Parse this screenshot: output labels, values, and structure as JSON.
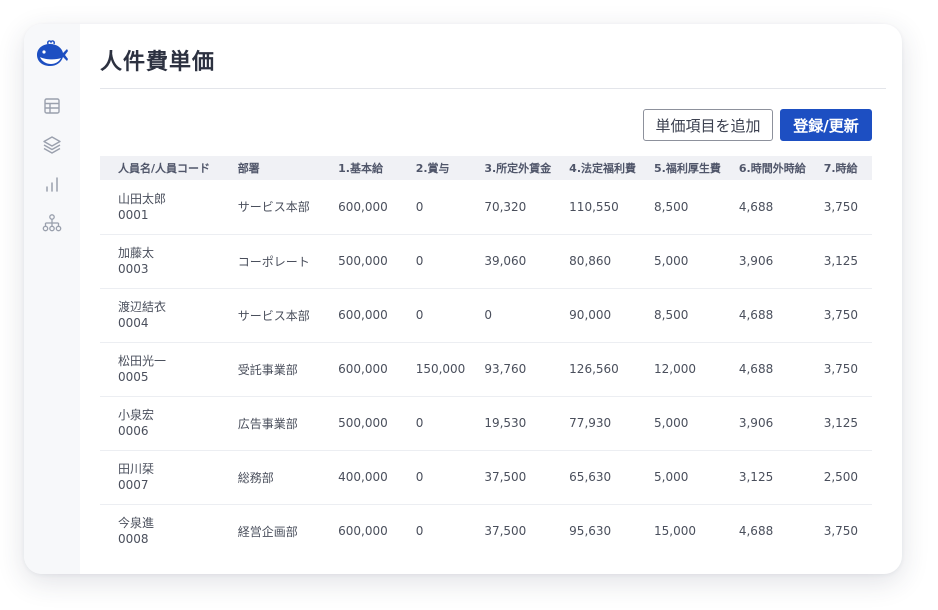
{
  "page": {
    "title": "人件費単価"
  },
  "colors": {
    "primary": "#1d4fc2",
    "logo": "#1d4fc2",
    "icon": "#9aa0ad"
  },
  "sidebar": {
    "items": [
      {
        "icon": "table-icon"
      },
      {
        "icon": "layers-icon"
      },
      {
        "icon": "bar-chart-icon"
      },
      {
        "icon": "org-chart-icon"
      }
    ]
  },
  "toolbar": {
    "add_item_label": "単価項目を追加",
    "save_label": "登録/更新"
  },
  "table": {
    "columns": [
      "人員名/人員コード",
      "部署",
      "1.基本給",
      "2.賞与",
      "3.所定外賃金",
      "4.法定福利費",
      "5.福利厚生費",
      "6.時間外時給",
      "7.時給"
    ],
    "rows": [
      {
        "name": "山田太郎",
        "code": "0001",
        "dept": "サービス本部",
        "base": "600,000",
        "bonus": "0",
        "overtime_wage": "70,320",
        "legal_welfare": "110,550",
        "welfare": "8,500",
        "overtime_hourly": "4,688",
        "hourly": "3,750"
      },
      {
        "name": "加藤太",
        "code": "0003",
        "dept": "コーポレート",
        "base": "500,000",
        "bonus": "0",
        "overtime_wage": "39,060",
        "legal_welfare": "80,860",
        "welfare": "5,000",
        "overtime_hourly": "3,906",
        "hourly": "3,125"
      },
      {
        "name": "渡辺結衣",
        "code": "0004",
        "dept": "サービス本部",
        "base": "600,000",
        "bonus": "0",
        "overtime_wage": "0",
        "legal_welfare": "90,000",
        "welfare": "8,500",
        "overtime_hourly": "4,688",
        "hourly": "3,750"
      },
      {
        "name": "松田光一",
        "code": "0005",
        "dept": "受託事業部",
        "base": "600,000",
        "bonus": "150,000",
        "overtime_wage": "93,760",
        "legal_welfare": "126,560",
        "welfare": "12,000",
        "overtime_hourly": "4,688",
        "hourly": "3,750"
      },
      {
        "name": "小泉宏",
        "code": "0006",
        "dept": "広告事業部",
        "base": "500,000",
        "bonus": "0",
        "overtime_wage": "19,530",
        "legal_welfare": "77,930",
        "welfare": "5,000",
        "overtime_hourly": "3,906",
        "hourly": "3,125"
      },
      {
        "name": "田川栞",
        "code": "0007",
        "dept": "総務部",
        "base": "400,000",
        "bonus": "0",
        "overtime_wage": "37,500",
        "legal_welfare": "65,630",
        "welfare": "5,000",
        "overtime_hourly": "3,125",
        "hourly": "2,500"
      },
      {
        "name": "今泉進",
        "code": "0008",
        "dept": "経営企画部",
        "base": "600,000",
        "bonus": "0",
        "overtime_wage": "37,500",
        "legal_welfare": "95,630",
        "welfare": "15,000",
        "overtime_hourly": "4,688",
        "hourly": "3,750"
      }
    ]
  }
}
